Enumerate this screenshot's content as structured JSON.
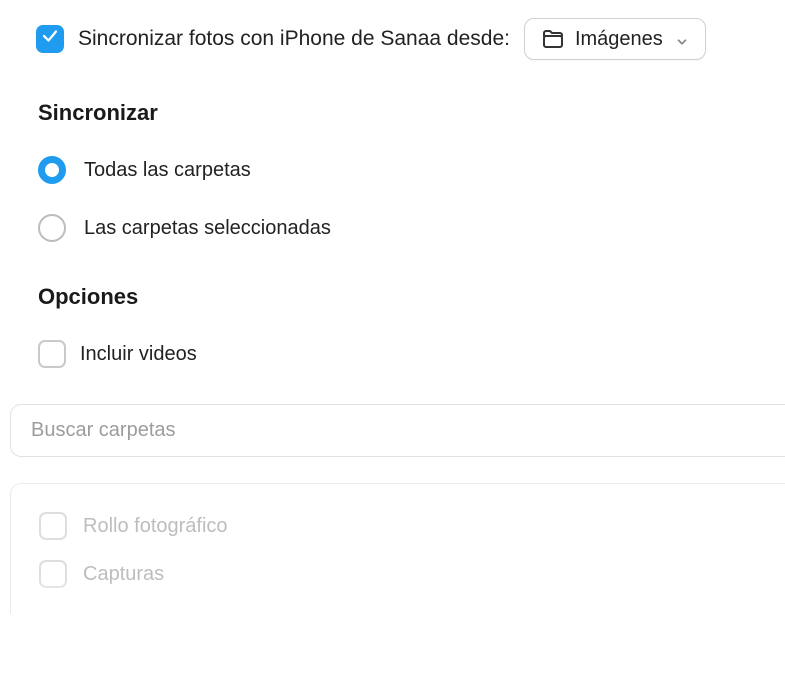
{
  "header": {
    "sync_label": "Sincronizar fotos con iPhone de Sanaa desde:",
    "dropdown_label": "Imágenes"
  },
  "sync": {
    "title": "Sincronizar",
    "option_all": "Todas las carpetas",
    "option_selected": "Las carpetas seleccionadas"
  },
  "options": {
    "title": "Opciones",
    "include_videos": "Incluir videos"
  },
  "search": {
    "placeholder": "Buscar carpetas"
  },
  "folders": {
    "item0": "Rollo fotográfico",
    "item1": "Capturas"
  }
}
